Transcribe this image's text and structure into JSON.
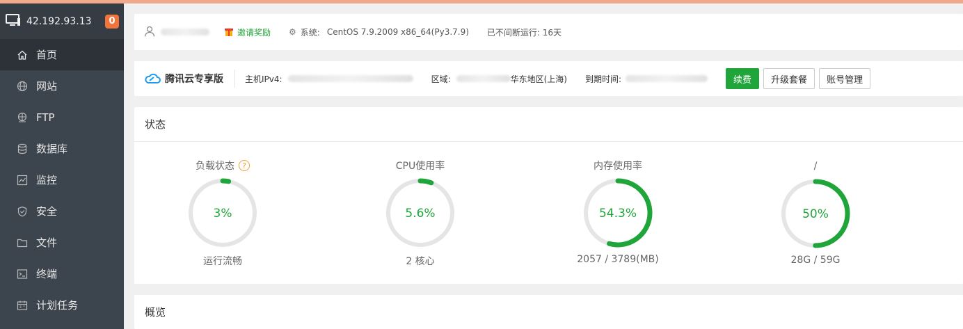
{
  "server": {
    "ip": "42.192.93.13",
    "badge": "0"
  },
  "sidebar": {
    "items": [
      {
        "label": "首页",
        "icon": "home-icon",
        "active": true
      },
      {
        "label": "网站",
        "icon": "globe-icon",
        "active": false
      },
      {
        "label": "FTP",
        "icon": "ftp-icon",
        "active": false
      },
      {
        "label": "数据库",
        "icon": "database-icon",
        "active": false
      },
      {
        "label": "监控",
        "icon": "monitor-icon",
        "active": false
      },
      {
        "label": "安全",
        "icon": "shield-icon",
        "active": false
      },
      {
        "label": "文件",
        "icon": "folder-icon",
        "active": false
      },
      {
        "label": "终端",
        "icon": "terminal-icon",
        "active": false
      },
      {
        "label": "计划任务",
        "icon": "calendar-icon",
        "active": false
      }
    ]
  },
  "infobar": {
    "invite": "邀请奖励",
    "system_label": "系统:",
    "system_value": "CentOS 7.9.2009 x86_64(Py3.7.9)",
    "uptime": "已不间断运行: 16天"
  },
  "cloud": {
    "brand": "腾讯云专享版",
    "host_label": "主机IPv4:",
    "region_label": "区域:",
    "region_value": "华东地区(上海)",
    "expire_label": "到期时间:",
    "renew": "续费",
    "upgrade": "升级套餐",
    "account": "账号管理"
  },
  "status": {
    "title": "状态",
    "gauges": [
      {
        "label": "负载状态",
        "value": "3%",
        "percent": 3,
        "sub": "运行流畅",
        "help": "?"
      },
      {
        "label": "CPU使用率",
        "value": "5.6%",
        "percent": 5.6,
        "sub": "2 核心"
      },
      {
        "label": "内存使用率",
        "value": "54.3%",
        "percent": 54.3,
        "sub": "2057 / 3789(MB)"
      },
      {
        "label": "/",
        "value": "50%",
        "percent": 50,
        "sub": "28G / 59G"
      }
    ],
    "color": "#20a53a",
    "track_color": "#e5e5e5"
  },
  "overview": {
    "title": "概览"
  }
}
